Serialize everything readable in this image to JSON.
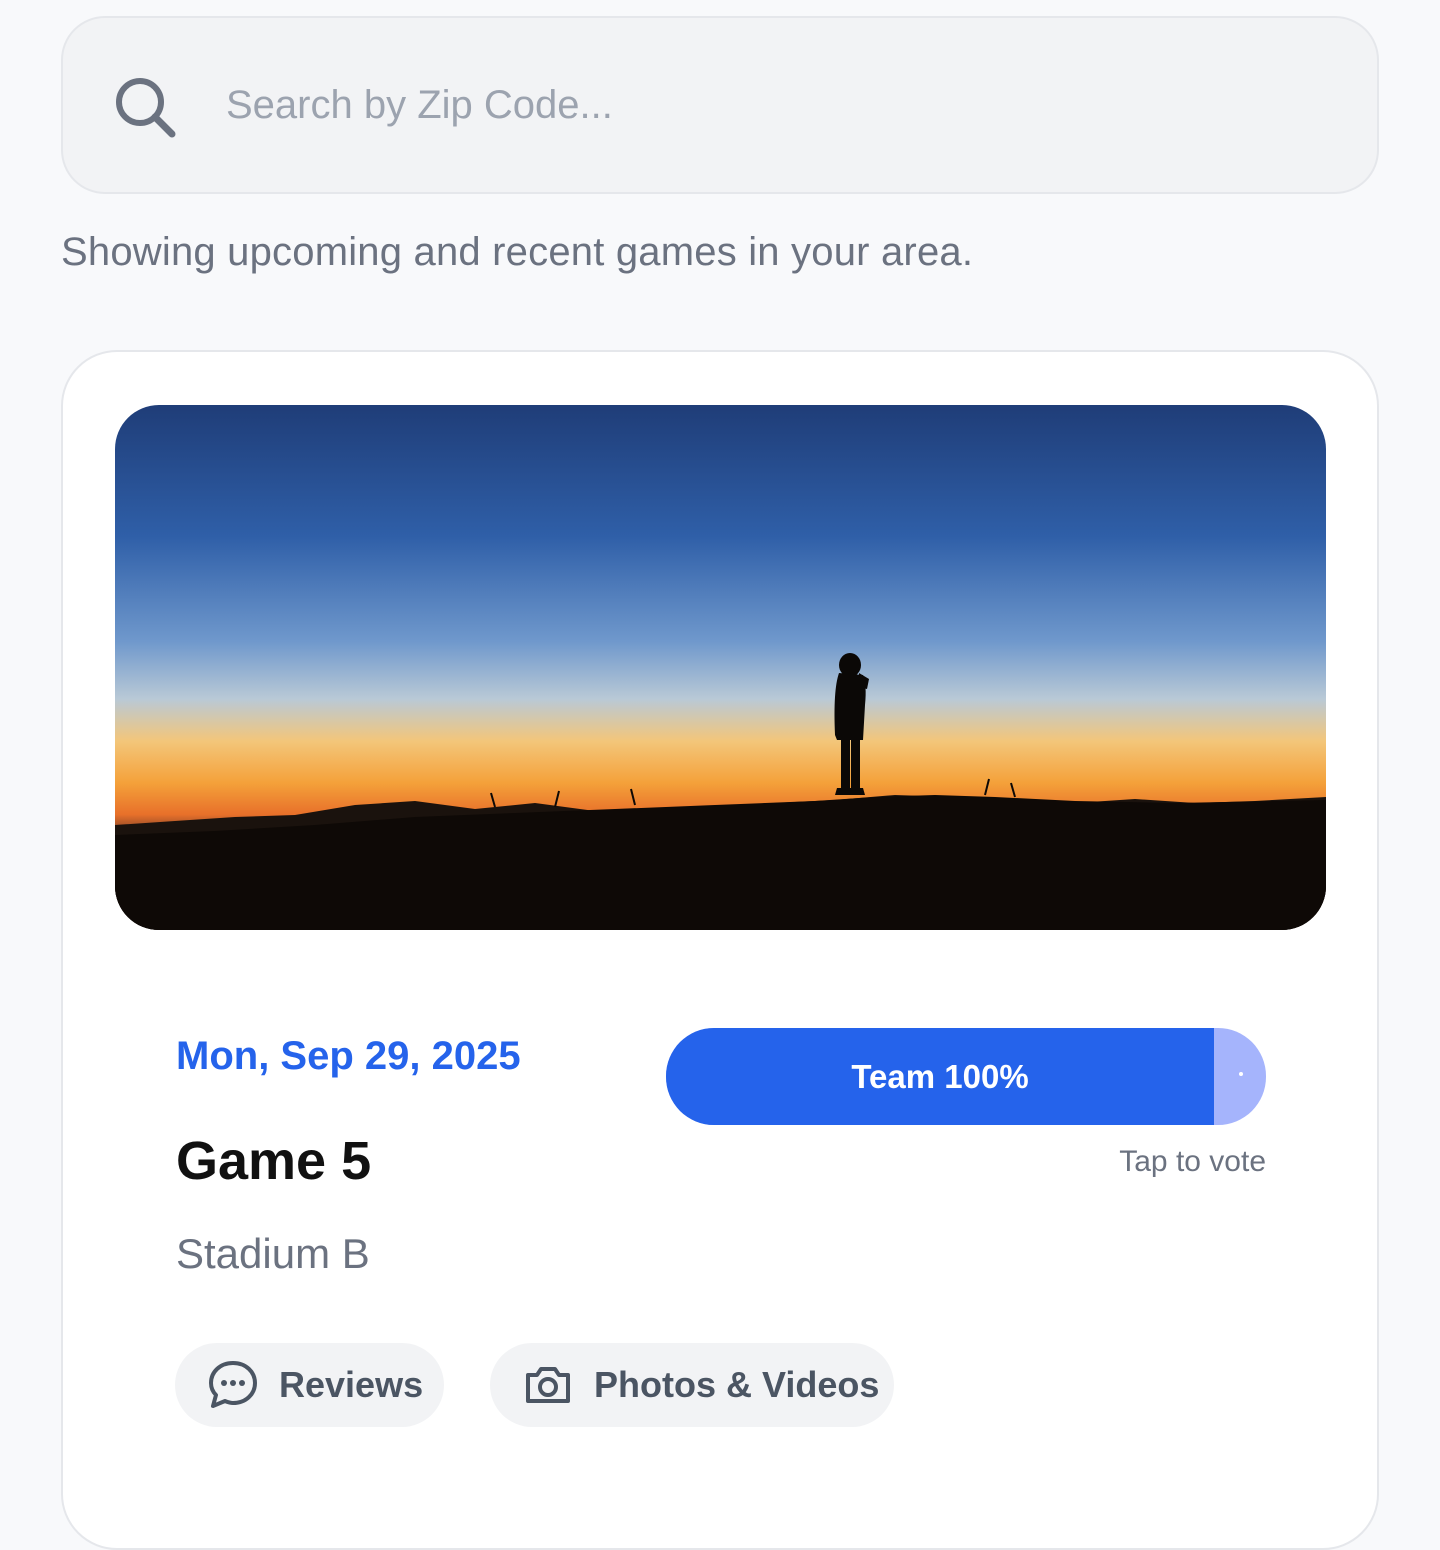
{
  "search": {
    "placeholder": "Search by Zip Code...",
    "icon": "search-icon"
  },
  "subtitle": "Showing upcoming and recent games in your area.",
  "game": {
    "image_description_icon": "hero-image",
    "date": "Mon, Sep 29, 2025",
    "title": "Game 5",
    "venue": "Stadium B",
    "vote": {
      "label": "Team 100%",
      "percent": 100,
      "hint": "Tap to vote"
    },
    "actions": [
      {
        "label": "Reviews",
        "icon": "chat-bubble-icon"
      },
      {
        "label": "Photos & Videos",
        "icon": "camera-icon"
      }
    ]
  },
  "colors": {
    "accent": "#2563eb",
    "vote_remainder": "#a5b4fc",
    "background": "#f8f9fb",
    "muted_text": "#6b7280"
  }
}
